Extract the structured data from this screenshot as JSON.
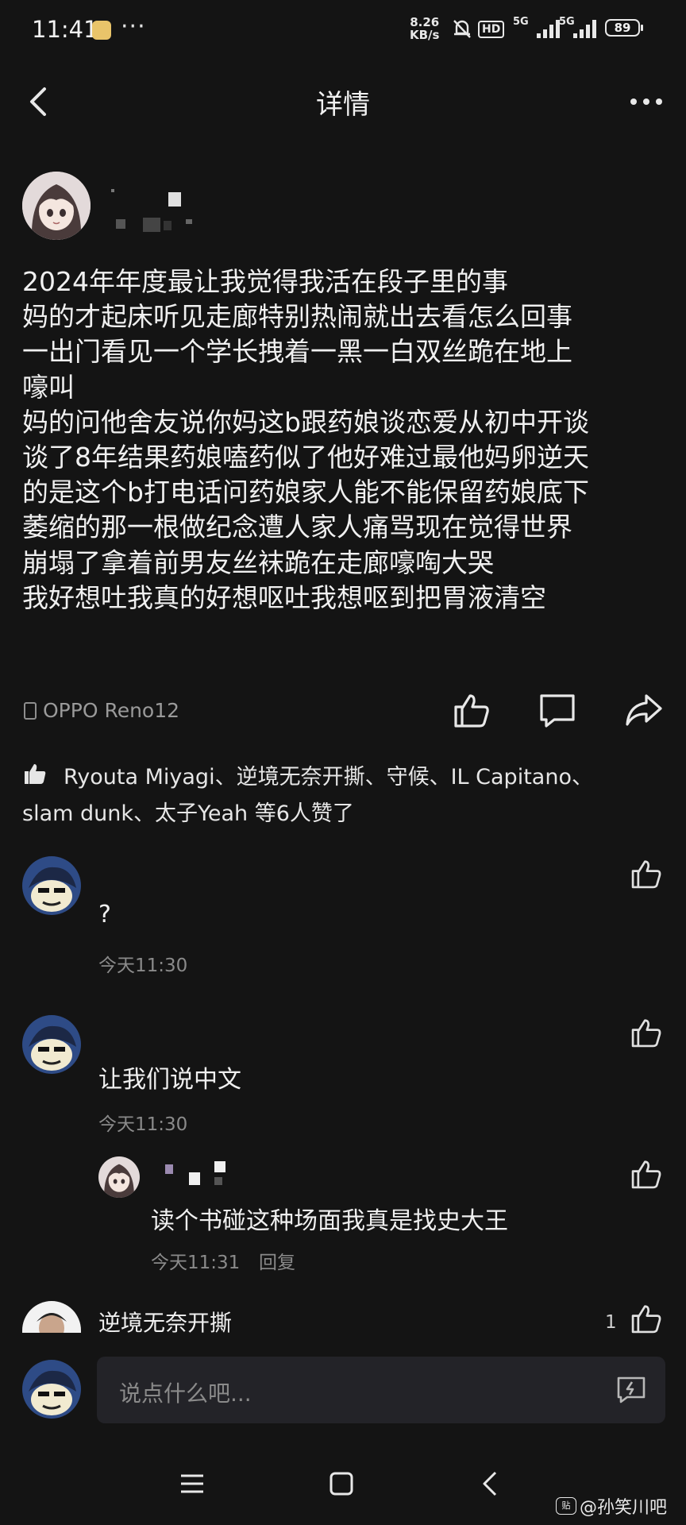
{
  "status_bar": {
    "time": "11:41",
    "more": "···",
    "speed_value": "8.26",
    "speed_unit": "KB/s",
    "hd": "HD",
    "net_1": "5G",
    "net_2": "5G",
    "battery": "89"
  },
  "header": {
    "title": "详情"
  },
  "post": {
    "device": "OPPO Reno12",
    "lines": [
      "2024年年度最让我觉得我活在段子里的事",
      "妈的才起床听见走廊特别热闹就出去看怎么回事",
      "一出门看见一个学长拽着一黑一白双丝跪在地上",
      "嚎叫",
      "妈的问他舍友说你妈这b跟药娘谈恋爱从初中开谈",
      "谈了8年结果药娘嗑药似了他好难过最他妈卵逆天",
      "的是这个b打电话问药娘家人能不能保留药娘底下",
      "萎缩的那一根做纪念遭人家人痛骂现在觉得世界",
      "崩塌了拿着前男友丝袜跪在走廊嚎啕大哭",
      "我好想吐我真的好想呕吐我想呕到把胃液清空"
    ],
    "likes_line1": "Ryouta Miyagi、逆境无奈开撕、守候、IL  Capitano、",
    "likes_line2": "slam dunk、太子Yeah 等6人赞了"
  },
  "comments": [
    {
      "text": "?",
      "time": "今天11:30"
    },
    {
      "text": "让我们说中文",
      "time": "今天11:30",
      "reply": {
        "text": "读个书碰这种场面我真是找史大王",
        "time": "今天11:31",
        "reply_label": "回复"
      }
    },
    {
      "author": "逆境无奈开撕",
      "like_count": "1"
    }
  ],
  "input": {
    "placeholder": "说点什么吧..."
  },
  "watermark": {
    "badge": "贴",
    "text": "@孙笑川吧"
  },
  "colors": {
    "background": "#141414",
    "input_bg": "#232328",
    "muted": "#8a8a8a"
  },
  "icons": [
    "back-icon",
    "more-icon",
    "thumb-up-icon",
    "comment-icon",
    "share-icon",
    "emoji-icon",
    "menu-icon",
    "home-icon"
  ]
}
